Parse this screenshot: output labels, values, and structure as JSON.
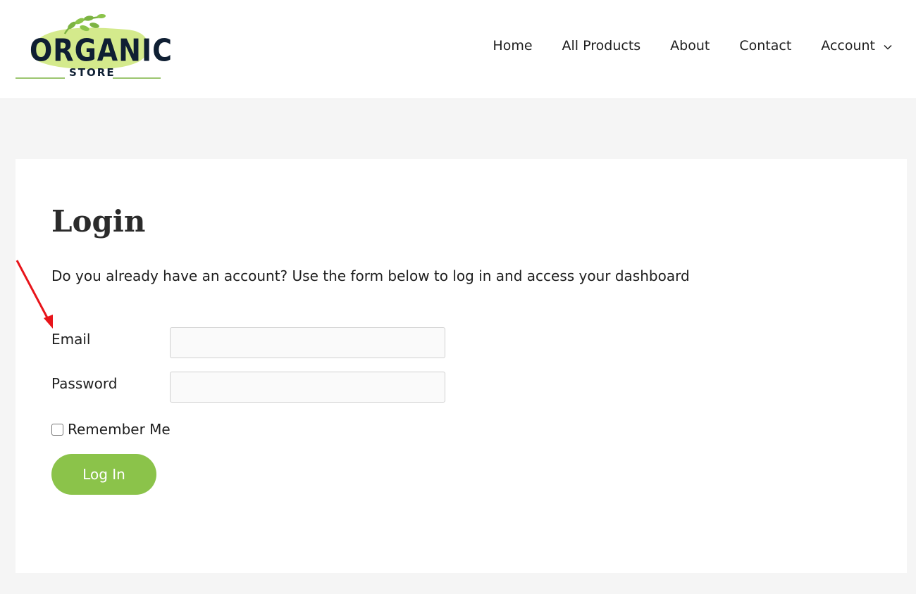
{
  "logo": {
    "title": "ORGANIC",
    "subtitle": "STORE",
    "leaf_color": "#7cb342",
    "splash_color": "#d4ea8c",
    "text_color": "#0f1f33"
  },
  "nav": {
    "items": [
      {
        "label": "Home"
      },
      {
        "label": "All Products"
      },
      {
        "label": "About"
      },
      {
        "label": "Contact"
      },
      {
        "label": "Account",
        "has_dropdown": true,
        "icon": "chevron-down-icon"
      }
    ]
  },
  "main": {
    "title": "Login",
    "intro": "Do you already have an account? Use the form below to log in and access your dashboard",
    "form": {
      "email_label": "Email",
      "email_value": "",
      "password_label": "Password",
      "password_value": "",
      "remember_label": "Remember Me",
      "remember_checked": false,
      "submit_label": "Log In"
    }
  },
  "annotation": {
    "icon": "red-arrow-icon",
    "color": "#e8141a"
  },
  "colors": {
    "accent": "#8bc34a",
    "page_background": "#f5f5f5",
    "card_background": "#ffffff"
  }
}
